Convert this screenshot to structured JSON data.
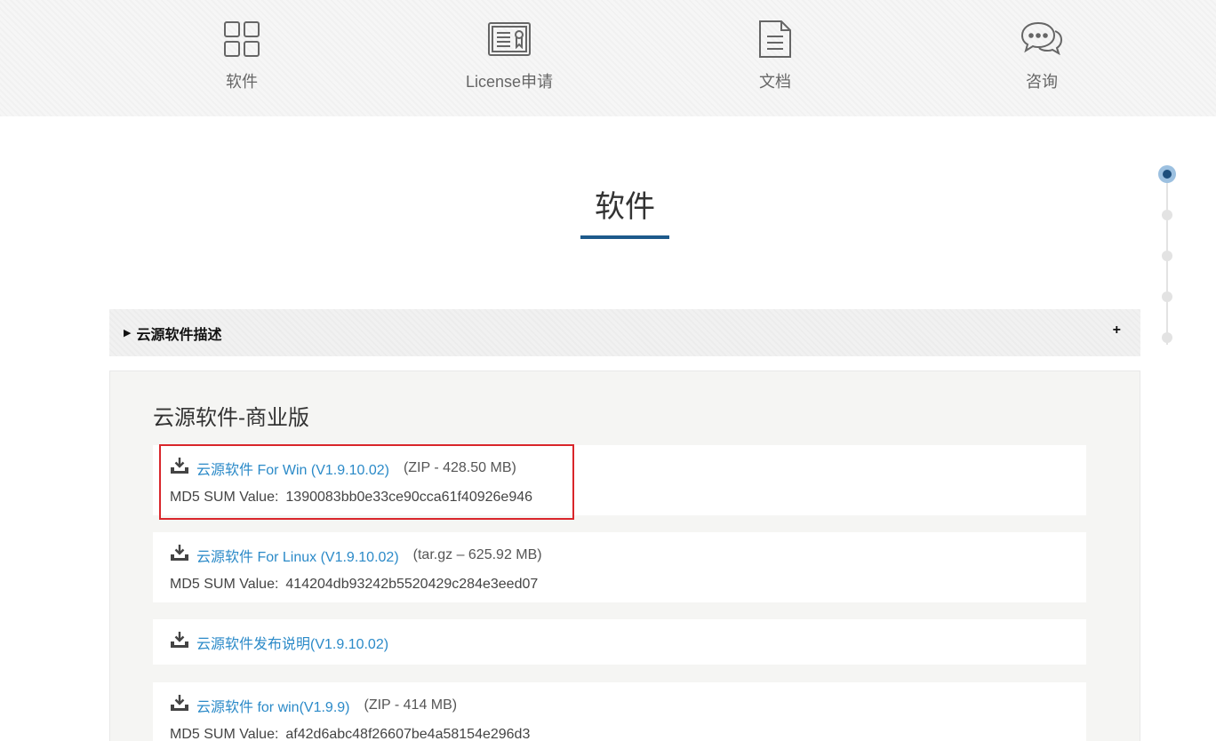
{
  "nav": {
    "items": [
      {
        "label": "软件",
        "icon": "grid-icon"
      },
      {
        "label": "License申请",
        "icon": "certificate-icon"
      },
      {
        "label": "文档",
        "icon": "document-icon"
      },
      {
        "label": "咨询",
        "icon": "chat-bubbles-icon"
      }
    ]
  },
  "section": {
    "title": "软件"
  },
  "accordion": {
    "label": "云源软件描述",
    "toggle": "+"
  },
  "panel": {
    "title": "云源软件-商业版",
    "downloads": [
      {
        "link": "云源软件 For Win (V1.9.10.02)",
        "size": "(ZIP - 428.50 MB)",
        "md5_label": "MD5 SUM Value:",
        "md5": "1390083bb0e33ce90cca61f40926e946"
      },
      {
        "link": "云源软件 For Linux (V1.9.10.02)",
        "size": "(tar.gz – 625.92 MB)",
        "md5_label": "MD5 SUM Value:",
        "md5": "414204db93242b5520429c284e3eed07"
      },
      {
        "link": "云源软件发布说明(V1.9.10.02)"
      },
      {
        "link": "云源软件 for win(V1.9.9)",
        "size": "(ZIP - 414 MB)",
        "md5_label": "MD5 SUM Value:",
        "md5": "af42d6abc48f26607be4a58154e296d3"
      }
    ]
  },
  "colors": {
    "accent": "#1d5a8b",
    "link": "#2b8ac8",
    "highlight": "#d9262b"
  }
}
